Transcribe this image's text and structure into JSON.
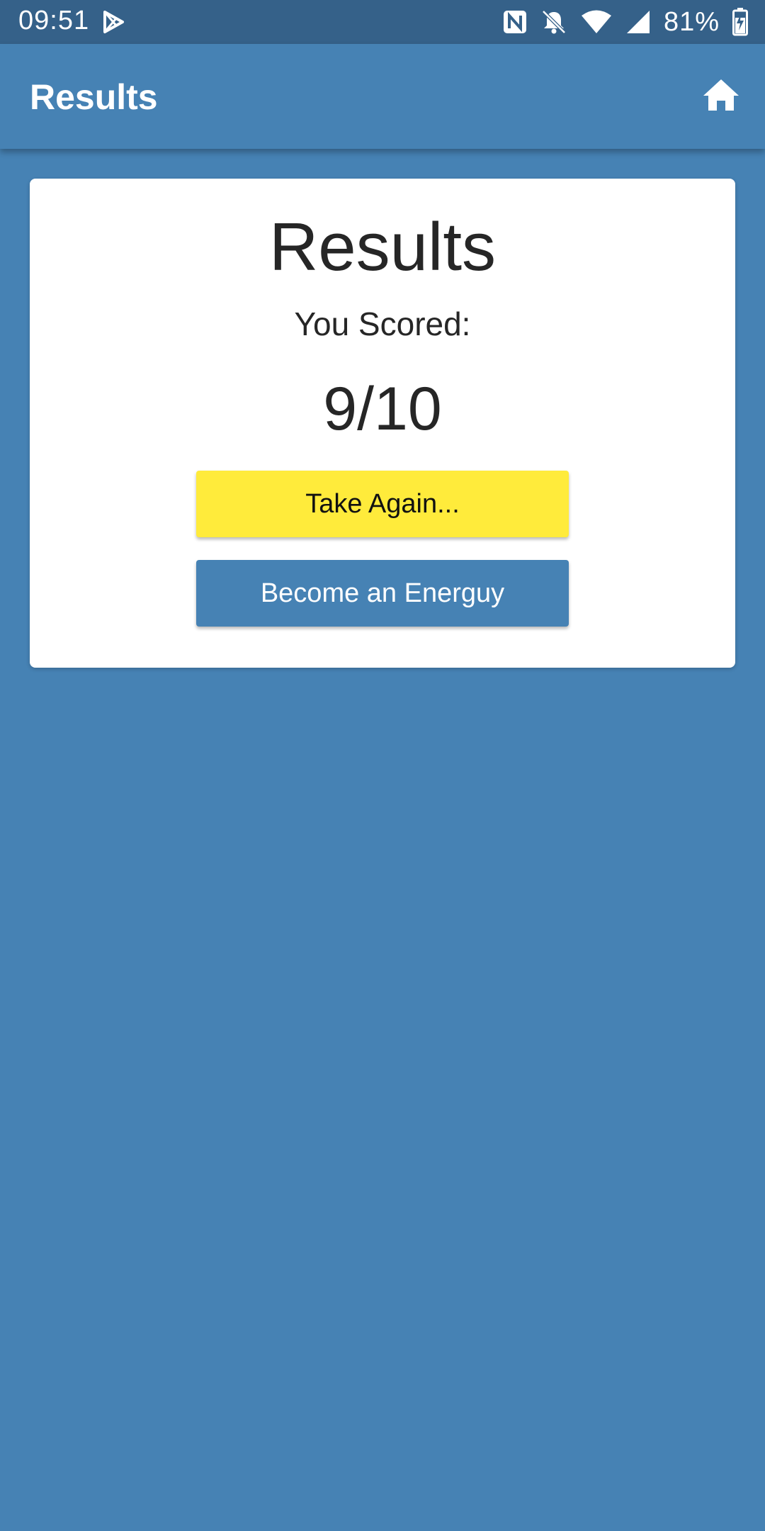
{
  "status_bar": {
    "time": "09:51",
    "battery": "81%",
    "icons": [
      "play-store-icon",
      "nfc-icon",
      "bell-off-icon",
      "wifi-icon",
      "signal-icon",
      "battery-charging-icon"
    ]
  },
  "app_bar": {
    "title": "Results",
    "home_icon": "home-icon"
  },
  "card": {
    "title": "Results",
    "subtitle": "You Scored:",
    "score": "9/10",
    "take_again_label": "Take Again...",
    "become_label": "Become an Energuy"
  },
  "colors": {
    "background": "#4682b4",
    "status_bar": "#356189",
    "take_again_button": "#ffeb3b",
    "become_button": "#4682b4",
    "card": "#ffffff"
  }
}
